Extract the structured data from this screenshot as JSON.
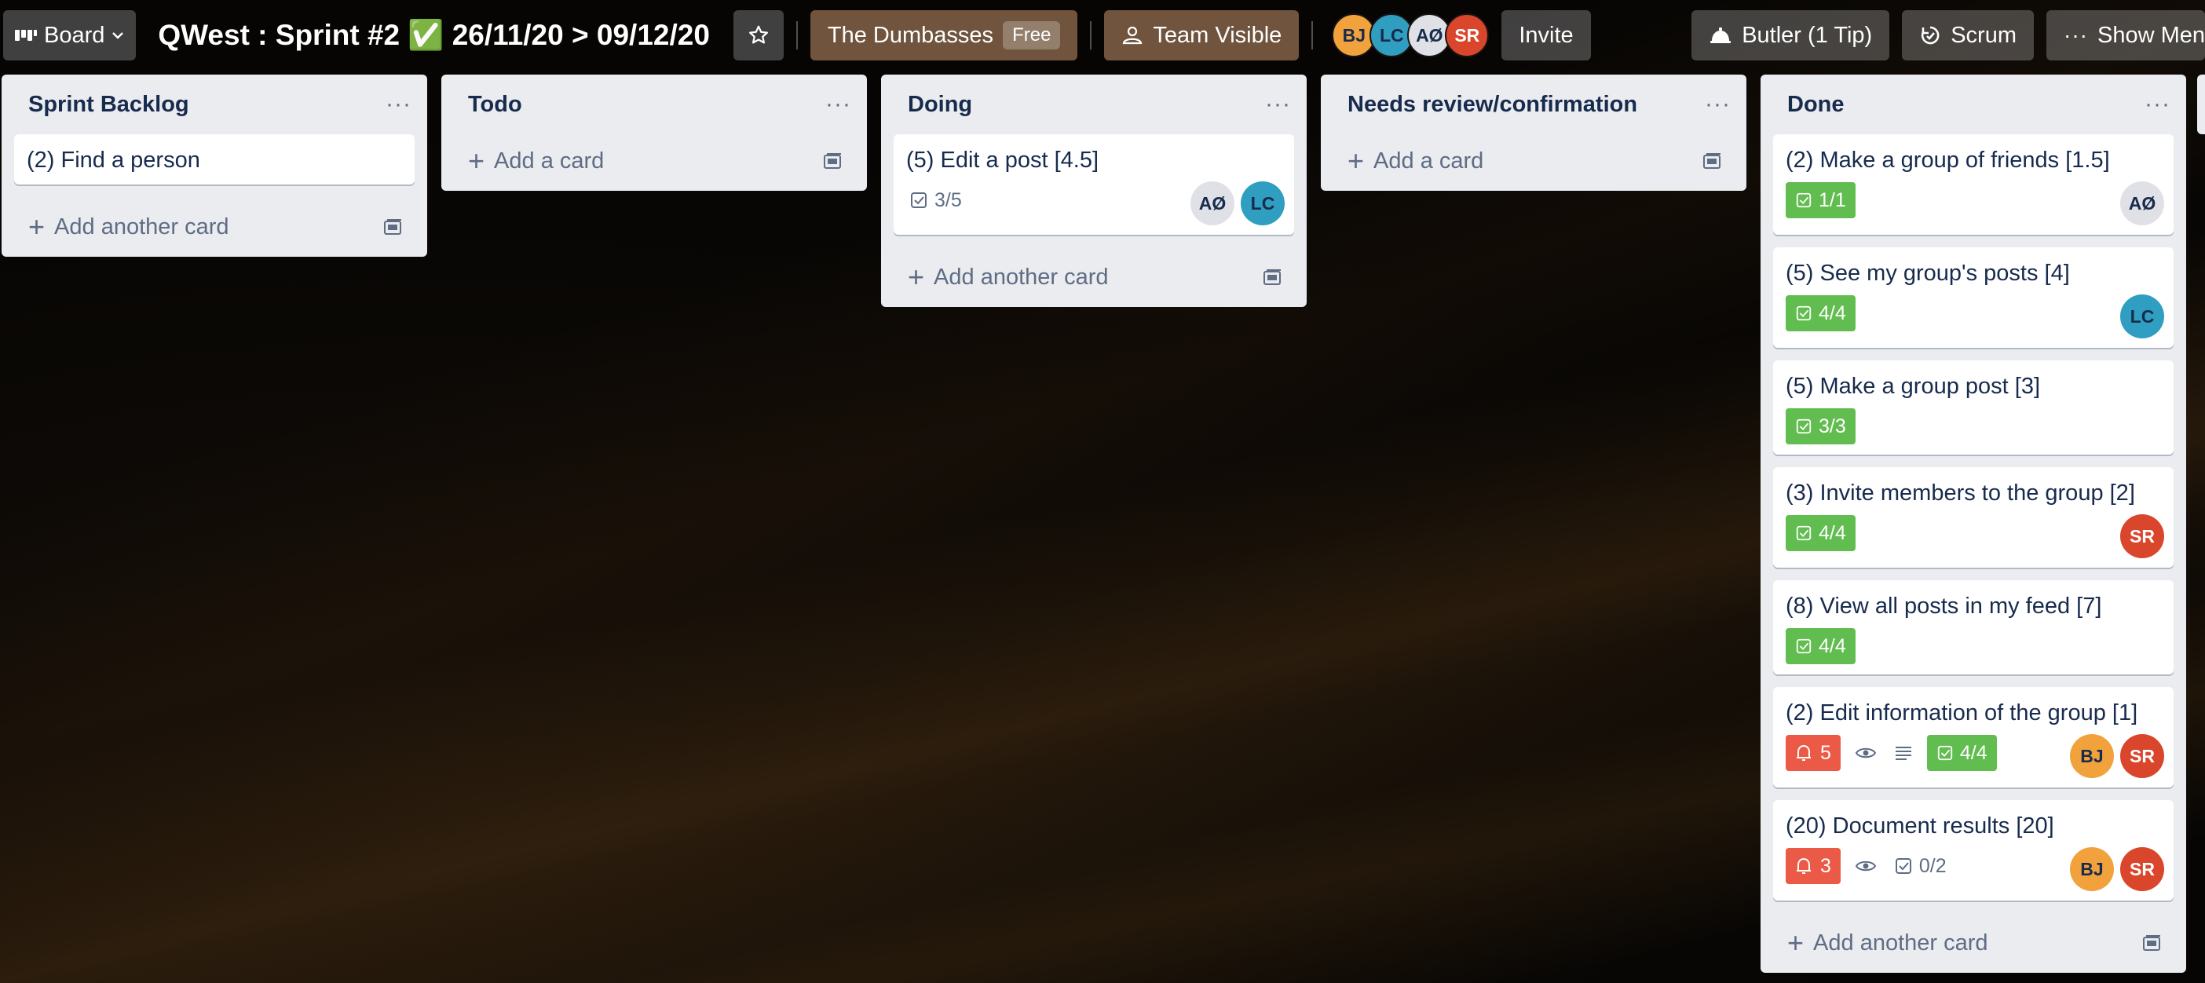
{
  "header": {
    "board_switcher": "Board",
    "board_title": "QWest : Sprint #2 ✅ 26/11/20 > 09/12/20",
    "team_name": "The Dumbasses",
    "team_badge": "Free",
    "visibility": "Team Visible",
    "members": [
      "BJ",
      "LC",
      "AØ",
      "SR"
    ],
    "invite": "Invite",
    "butler": "Butler (1 Tip)",
    "scrum": "Scrum",
    "show_menu": "Show Men"
  },
  "lists": [
    {
      "title": "Sprint Backlog",
      "cards": [
        {
          "title": "(2) Find a person"
        }
      ],
      "add_label": "Add another card"
    },
    {
      "title": "Todo",
      "cards": [],
      "add_label": "Add a card"
    },
    {
      "title": "Doing",
      "cards": [
        {
          "title": "(5) Edit a post [4.5]",
          "checklist": "3/5",
          "members": [
            "AØ",
            "LC"
          ]
        }
      ],
      "add_label": "Add another card"
    },
    {
      "title": "Needs review/confirmation",
      "cards": [],
      "add_label": "Add a card"
    },
    {
      "title": "Done",
      "cards": [
        {
          "title": "(2) Make a group of friends [1.5]",
          "checklist": "1/1",
          "members": [
            "AØ"
          ]
        },
        {
          "title": "(5) See my group's posts [4]",
          "checklist": "4/4",
          "members": [
            "LC"
          ]
        },
        {
          "title": "(5) Make a group post [3]",
          "checklist": "3/3",
          "members": []
        },
        {
          "title": "(3) Invite members to the group [2]",
          "checklist": "4/4",
          "members": [
            "SR"
          ]
        },
        {
          "title": "(8) View all posts in my feed [7]",
          "checklist": "4/4",
          "members": []
        },
        {
          "title": "(2) Edit information of the group [1]",
          "notifications": "5",
          "checklist": "4/4",
          "members": [
            "BJ",
            "SR"
          ]
        },
        {
          "title": "(20) Document results [20]",
          "notifications": "3",
          "checklist": "0/2",
          "members": [
            "BJ",
            "SR"
          ]
        }
      ],
      "add_label": "Add another card"
    }
  ],
  "colors": {
    "checklist_complete": "#61bd4f",
    "notification": "#eb5a46",
    "list_bg": "#ebecf0"
  }
}
